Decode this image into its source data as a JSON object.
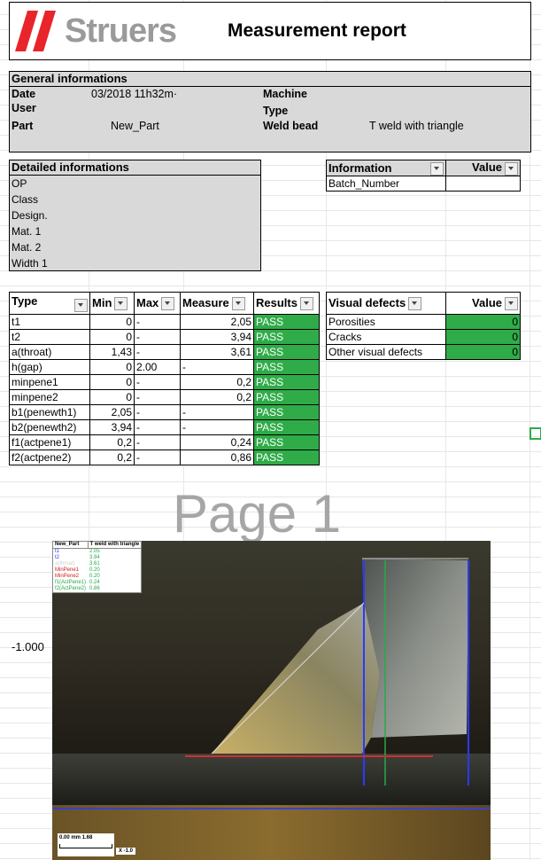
{
  "header": {
    "brand": "Struers",
    "title": "Measurement report"
  },
  "general": {
    "heading": "General informations",
    "date_label": "Date",
    "date_value": "03/2018 11h32m·",
    "user_label": "User",
    "part_label": "Part",
    "part_value": "New_Part",
    "machine_label": "Machine",
    "type_label": "Type",
    "weld_label": "Weld bead",
    "weld_value": "T weld with triangle"
  },
  "detailed": {
    "heading": "Detailed informations",
    "items": [
      "OP",
      "Class",
      "Design.",
      "Mat. 1",
      "Mat. 2",
      "Width 1"
    ]
  },
  "info_table": {
    "headers": [
      "Information",
      "Value"
    ],
    "rows": [
      [
        "Batch_Number",
        ""
      ]
    ]
  },
  "measure_table": {
    "headers": [
      "Type",
      "Min",
      "Max",
      "Measure",
      "Results"
    ],
    "rows": [
      [
        "t1",
        "0",
        "-",
        "2,05",
        "PASS"
      ],
      [
        "t2",
        "0",
        "-",
        "3,94",
        "PASS"
      ],
      [
        "a(throat)",
        "1,43",
        "-",
        "3,61",
        "PASS"
      ],
      [
        "h(gap)",
        "0",
        "2.00",
        "-",
        "PASS"
      ],
      [
        "minpene1",
        "0",
        "-",
        "0,2",
        "PASS"
      ],
      [
        "minpene2",
        "0",
        "-",
        "0,2",
        "PASS"
      ],
      [
        "b1(penewth1)",
        "2,05",
        "-",
        "-",
        "PASS"
      ],
      [
        "b2(penewth2)",
        "3,94",
        "-",
        "-",
        "PASS"
      ],
      [
        "f1(actpene1)",
        "0,2",
        "-",
        "0,24",
        "PASS"
      ],
      [
        "f2(actpene2)",
        "0,2",
        "-",
        "0,86",
        "PASS"
      ]
    ]
  },
  "visual_table": {
    "headers": [
      "Visual defects",
      "Value"
    ],
    "rows": [
      [
        "Porosities",
        "0"
      ],
      [
        "Cracks",
        "0"
      ],
      [
        "Other visual defects",
        "0"
      ]
    ]
  },
  "page_watermark": "Page 1",
  "side_value": "-1.000",
  "micrograph": {
    "legend_header": [
      "New_Part",
      "T weld with triangle"
    ],
    "legend_rows": [
      [
        "t1",
        "2.05"
      ],
      [
        "t2",
        "3.94"
      ],
      [
        "a(throat)",
        "3.61"
      ],
      [
        "MinPene1",
        "0.20"
      ],
      [
        "MinPene2",
        "0.20"
      ],
      [
        "f1(ActPene1)",
        "0.24"
      ],
      [
        "f2(ActPene2)",
        "0.86"
      ]
    ],
    "scale_text": "0.00   mm   1.68",
    "zoom_text": "X -1.0"
  },
  "colors": {
    "pass": "#2fac48",
    "brand_red": "#e8252b",
    "brand_grey": "#9a9a9a"
  }
}
